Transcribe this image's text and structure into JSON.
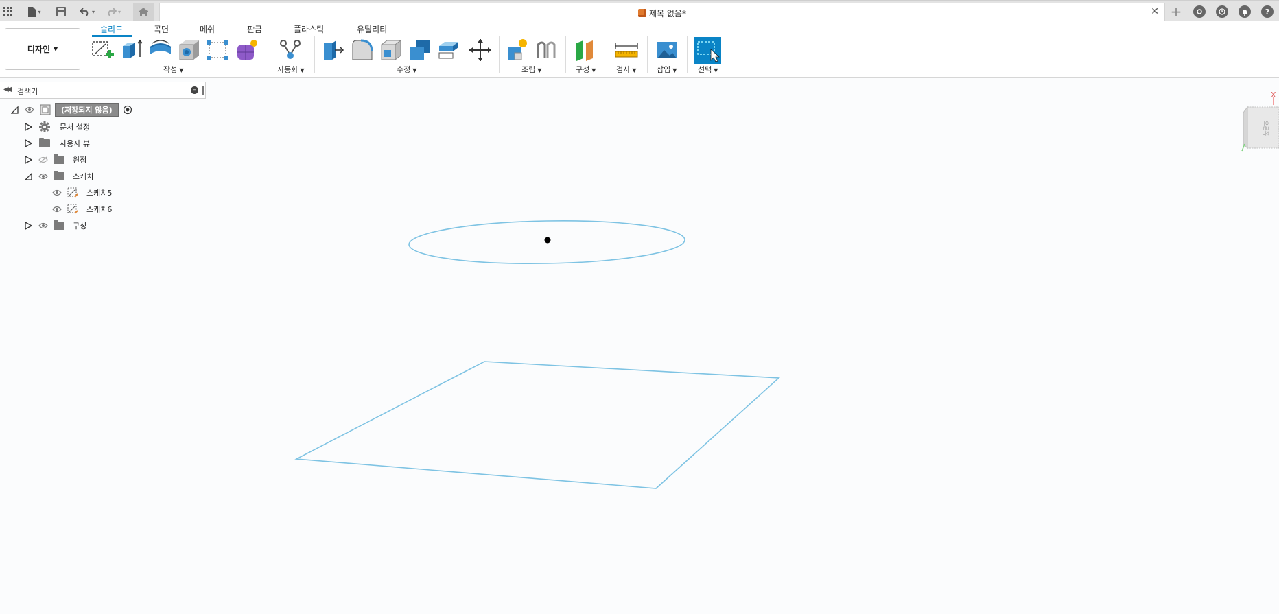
{
  "topbar": {
    "doc_title": "제목 없음*",
    "close_glyph": "✕",
    "add_glyph": "+",
    "help_glyph": "?"
  },
  "ribbon": {
    "workspace_label": "디자인",
    "tabs": [
      {
        "label": "솔리드",
        "active": true
      },
      {
        "label": "곡면",
        "active": false
      },
      {
        "label": "메쉬",
        "active": false
      },
      {
        "label": "판금",
        "active": false
      },
      {
        "label": "플라스틱",
        "active": false
      },
      {
        "label": "유틸리티",
        "active": false
      }
    ],
    "groups": {
      "create": "작성",
      "automate": "자동화",
      "modify": "수정",
      "assemble": "조립",
      "construct": "구성",
      "inspect": "검사",
      "insert": "삽입",
      "select": "선택"
    },
    "accent_color": "#0a84c6"
  },
  "browser": {
    "title": "검색기",
    "root_label": "(저장되지 않음)",
    "items": [
      {
        "label": "문서 설정",
        "icon": "gear-icon"
      },
      {
        "label": "사용자 뷰",
        "icon": "folder-icon"
      },
      {
        "label": "원점",
        "icon": "folder-icon",
        "hidden": true
      },
      {
        "label": "스케치",
        "icon": "folder-icon",
        "expanded": true
      },
      {
        "label": "스케치5",
        "icon": "sketch-icon"
      },
      {
        "label": "스케치6",
        "icon": "sketch-icon"
      },
      {
        "label": "구성",
        "icon": "folder-icon"
      }
    ]
  },
  "viewcube": {
    "face_label": "오른쪽",
    "axis_x": "X"
  },
  "sketch_color": "#7ec3e3"
}
